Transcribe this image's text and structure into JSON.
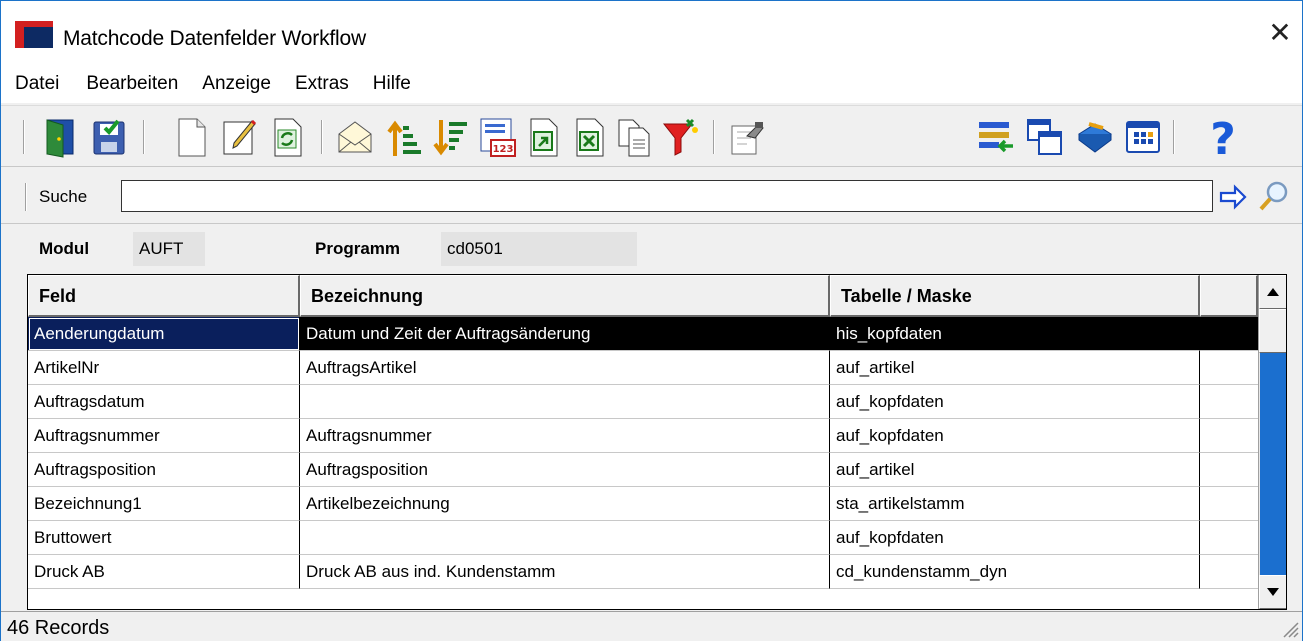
{
  "window": {
    "title": "Matchcode Datenfelder Workflow",
    "close_symbol": "✕"
  },
  "menu": {
    "items": [
      "Datei",
      "Bearbeiten",
      "Anzeige",
      "Extras",
      "Hilfe"
    ]
  },
  "toolbar": {
    "buttons": [
      "exit-door-icon",
      "save-icon",
      "new-document-icon",
      "edit-icon",
      "refresh-icon",
      "mail-icon",
      "sort-ascending-icon",
      "sort-descending-icon",
      "calendar-123-icon",
      "export-icon",
      "excel-export-icon",
      "copy-icon",
      "filter-icon",
      "properties-icon",
      "import-list-icon",
      "windows-icon",
      "book-icon",
      "grid-view-icon",
      "help-icon"
    ],
    "help_symbol": "?"
  },
  "search": {
    "label": "Suche",
    "value": "",
    "go_icon": "arrow-right-icon",
    "find_icon": "magnifier-icon"
  },
  "fields": {
    "modul_label": "Modul",
    "modul_value": "AUFT",
    "programm_label": "Programm",
    "programm_value": "cd0501"
  },
  "grid": {
    "columns": [
      "Feld",
      "Bezeichnung",
      "Tabelle / Maske",
      ""
    ],
    "rows": [
      [
        "Aenderungdatum",
        "Datum und Zeit der Auftragsänderung",
        "his_kopfdaten",
        ""
      ],
      [
        "ArtikelNr",
        "AuftragsArtikel",
        "auf_artikel",
        ""
      ],
      [
        "Auftragsdatum",
        "",
        "auf_kopfdaten",
        ""
      ],
      [
        "Auftragsnummer",
        "Auftragsnummer",
        "auf_kopfdaten",
        ""
      ],
      [
        "Auftragsposition",
        "Auftragsposition",
        "auf_artikel",
        ""
      ],
      [
        "Bezeichnung1",
        "Artikelbezeichnung",
        "sta_artikelstamm",
        ""
      ],
      [
        "Bruttowert",
        "",
        "auf_kopfdaten",
        ""
      ],
      [
        "Druck AB",
        "Druck AB aus ind. Kundenstamm",
        "cd_kundenstamm_dyn",
        ""
      ]
    ],
    "selected_row": 0
  },
  "status": {
    "text": "46 Records"
  },
  "colors": {
    "accent": "#1c73c9",
    "selection": "#000000",
    "scroll_track": "#1b6fcf"
  }
}
